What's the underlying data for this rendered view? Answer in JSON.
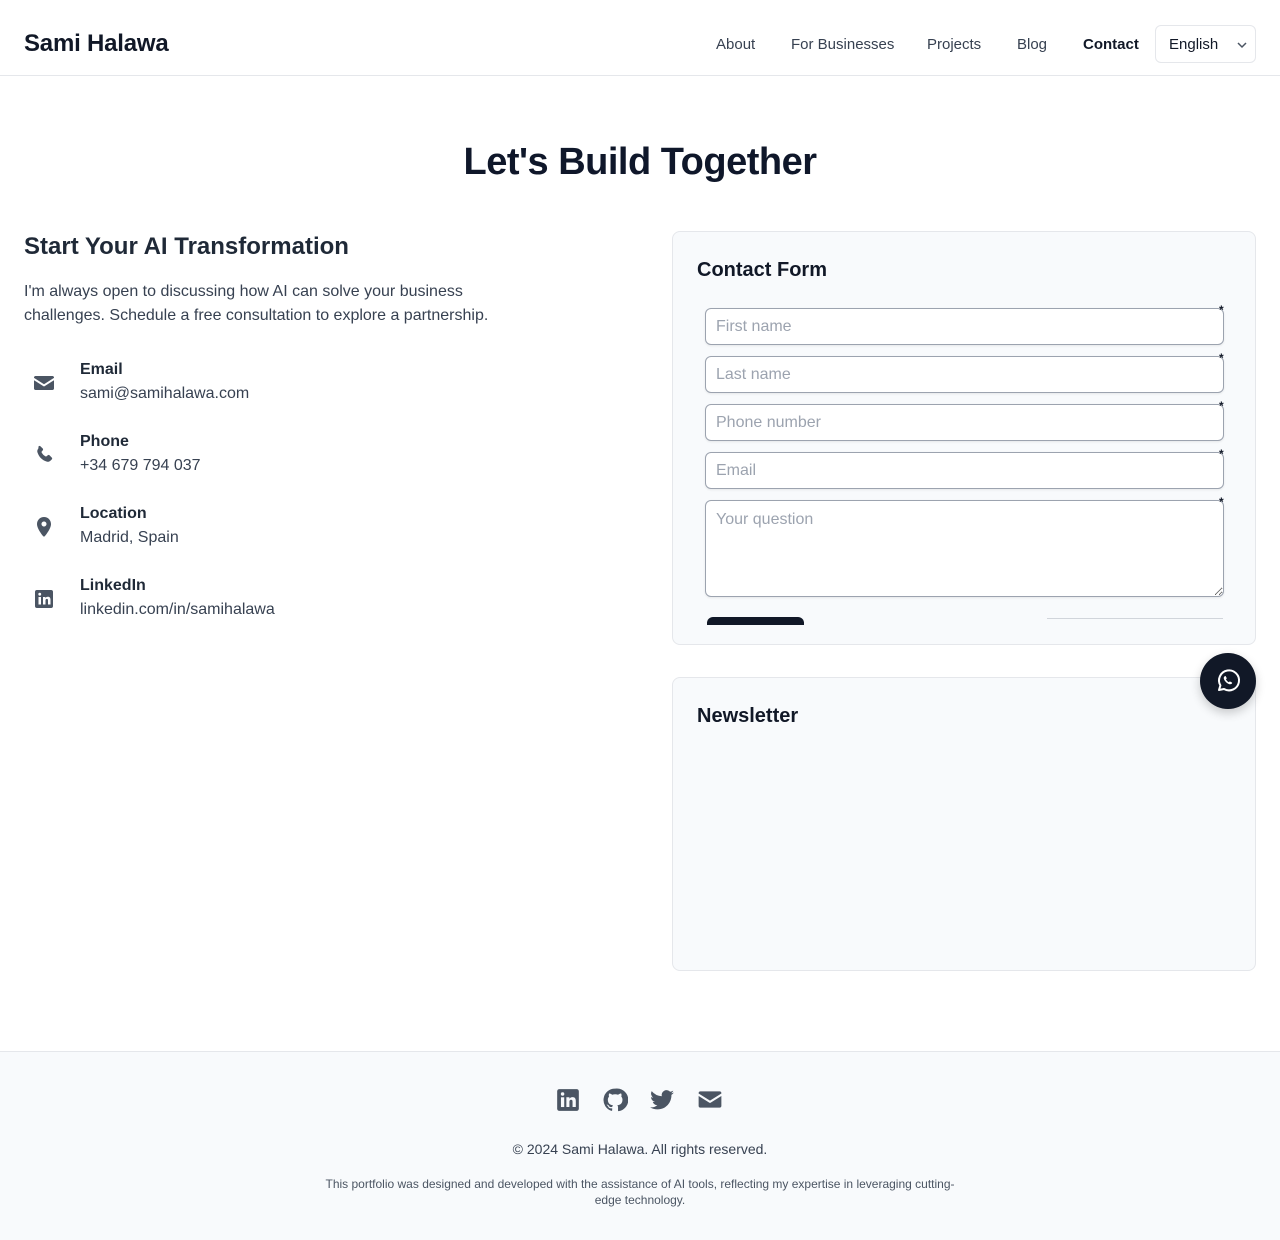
{
  "header": {
    "brand": "Sami Halawa",
    "nav": [
      {
        "label": "About"
      },
      {
        "label": "For Businesses"
      },
      {
        "label": "Projects"
      },
      {
        "label": "Blog"
      },
      {
        "label": "Contact"
      }
    ],
    "language": "English"
  },
  "hero": {
    "title": "Let's Build Together"
  },
  "contact_info": {
    "title": "Start Your AI Transformation",
    "intro": "I'm always open to discussing how AI can solve your business challenges. Schedule a free consultation to explore a partnership.",
    "items": [
      {
        "icon": "envelope-icon",
        "label": "Email",
        "value": "sami@samihalawa.com"
      },
      {
        "icon": "phone-icon",
        "label": "Phone",
        "value": "+34 679 794 037"
      },
      {
        "icon": "map-pin-icon",
        "label": "Location",
        "value": "Madrid, Spain"
      },
      {
        "icon": "linkedin-icon",
        "label": "LinkedIn",
        "value": "linkedin.com/in/samihalawa"
      }
    ]
  },
  "contact_form": {
    "title": "Contact Form",
    "required_marker": "*",
    "fields": {
      "first_name": {
        "placeholder": "First name"
      },
      "last_name": {
        "placeholder": "Last name"
      },
      "phone": {
        "placeholder": "Phone number"
      },
      "email": {
        "placeholder": "Email"
      },
      "question": {
        "placeholder": "Your question"
      }
    }
  },
  "newsletter": {
    "title": "Newsletter"
  },
  "footer": {
    "social_icons": [
      "linkedin-icon",
      "github-icon",
      "twitter-icon",
      "envelope-icon"
    ],
    "copyright": "© 2024 Sami Halawa. All rights reserved.",
    "disclaimer": "This portfolio was designed and developed with the assistance of AI tools, reflecting my expertise in leveraging cutting-edge technology."
  },
  "colors": {
    "text_dark": "#111827",
    "text_muted": "#374151",
    "icon": "#4b5563",
    "card_bg": "#f8fafc",
    "border": "#e5e7eb",
    "whatsapp_button": "#111827"
  }
}
